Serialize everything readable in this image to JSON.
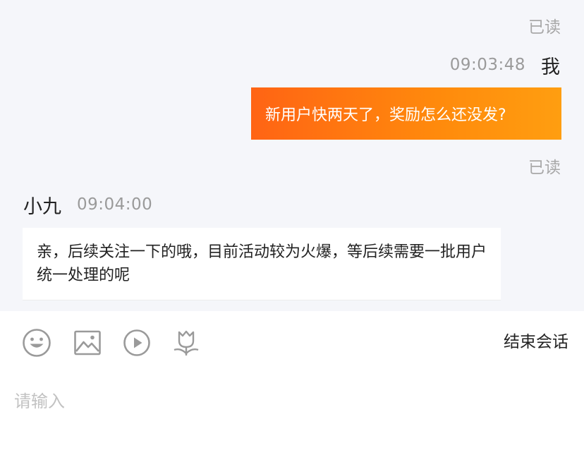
{
  "conversation": {
    "outgoing": {
      "read_status_top": "已读",
      "time": "09:03:48",
      "sender": "我",
      "text": "新用户快两天了，奖励怎么还没发?"
    },
    "incoming": {
      "read_status_top": "已读",
      "sender": "小九",
      "time": "09:04:00",
      "text": "亲，后续关注一下的哦，目前活动较为火爆，等后续需要一批用户统一处理的呢"
    }
  },
  "toolbar": {
    "icons": [
      "emoji-icon",
      "image-icon",
      "video-icon",
      "flower-icon"
    ],
    "end_session_label": "结束会话"
  },
  "composer": {
    "placeholder": "请输入"
  },
  "colors": {
    "bubble_gradient_start": "#ff6414",
    "bubble_gradient_end": "#ff9e10",
    "chat_background": "#f5f6fa",
    "muted_text": "#a8a8a8",
    "icon_gray": "#9a9a9a"
  }
}
